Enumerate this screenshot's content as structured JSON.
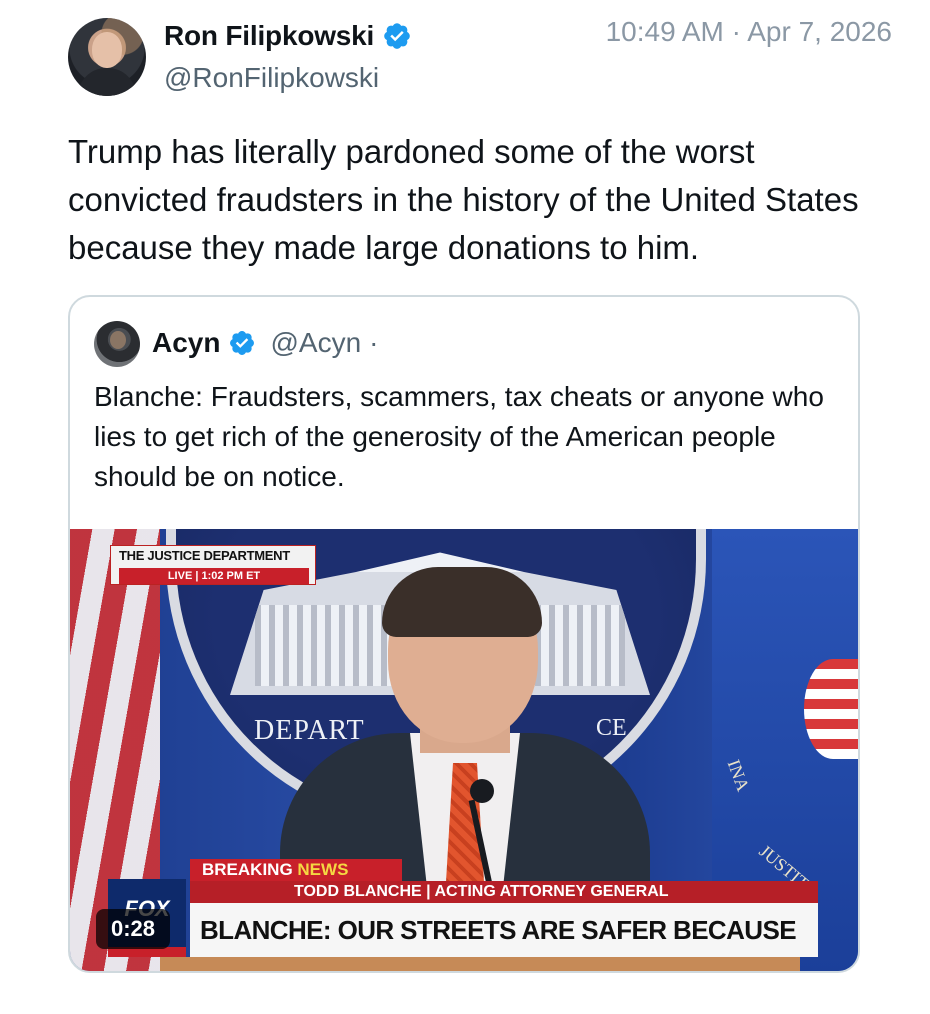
{
  "tweet": {
    "author_name": "Ron Filipkowski",
    "author_handle": "@RonFilipkowski",
    "timestamp": "10:49 AM · Apr 7, 2026",
    "text": "Trump has literally pardoned some of the worst convicted fraudsters in the history of the United States because they made large donations to him."
  },
  "quote": {
    "author_name": "Acyn",
    "author_handle": "@Acyn",
    "separator": "·",
    "text": "Blanche: Fraudsters, scammers, tax cheats or anyone who lies to get rich of the generosity of the American people should be on notice."
  },
  "video": {
    "duration": "0:28",
    "source_tag": "THE JUSTICE DEPARTMENT",
    "live_label": "LIVE | 1:02 PM ET",
    "breaking_label": "BREAKING",
    "news_label": "NEWS",
    "lower_third_name": "TODD BLANCHE | ACTING ATTORNEY GENERAL",
    "headline": "BLANCHE: OUR STREETS ARE SAFER BECAUSE OF BONDI",
    "seal_text_left": "DEPART",
    "seal_text_right": "CE",
    "seal_side_text": "INA",
    "seal_side_text2": "JUSTITI",
    "logo_text": "FOX"
  },
  "colors": {
    "verified": "#1d9bf0",
    "text_primary": "#0f1419",
    "text_secondary": "#536471",
    "border": "#cfd9de"
  }
}
